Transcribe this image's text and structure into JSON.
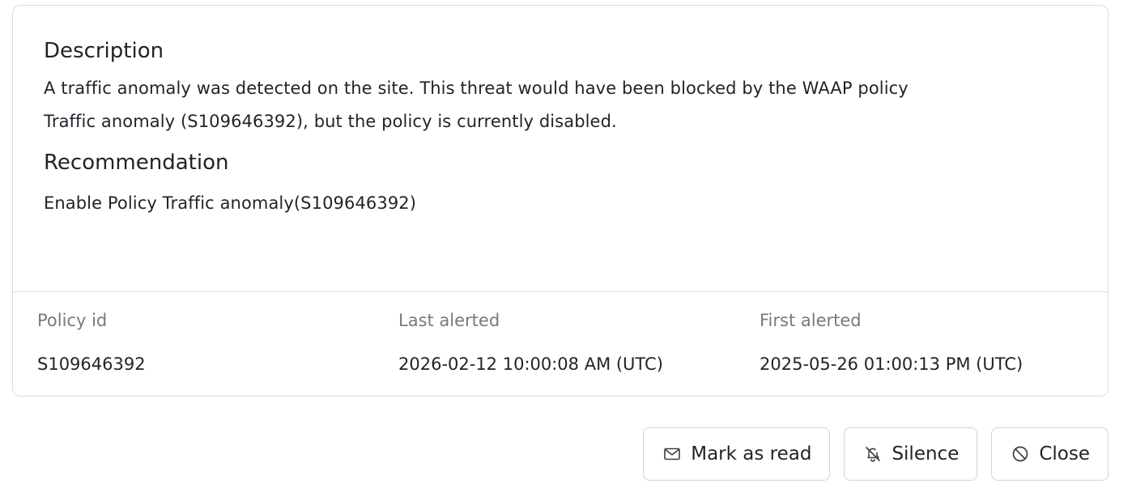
{
  "details": {
    "description_heading": "Description",
    "description_text_line1": "A traffic anomaly was detected on the site. This threat would have been blocked by the WAAP policy",
    "description_text_line2": "Traffic anomaly (S109646392), but the policy is currently disabled.",
    "recommendation_heading": "Recommendation",
    "recommendation_text": "Enable Policy Traffic anomaly(S109646392)"
  },
  "meta": [
    {
      "label": "Policy id",
      "value": "S109646392"
    },
    {
      "label": "Last alerted",
      "value": "2026-02-12 10:00:08 AM (UTC)"
    },
    {
      "label": "First alerted",
      "value": "2025-05-26 01:00:13 PM (UTC)"
    }
  ],
  "actions": {
    "mark_as_read": {
      "label": "Mark as read",
      "icon": "envelope-icon"
    },
    "silence": {
      "label": "Silence",
      "icon": "bell-off-icon"
    },
    "close": {
      "label": "Close",
      "icon": "ban-icon"
    }
  },
  "colors": {
    "border": "#d9dce1",
    "text": "#1f2329",
    "muted": "#737a85"
  }
}
